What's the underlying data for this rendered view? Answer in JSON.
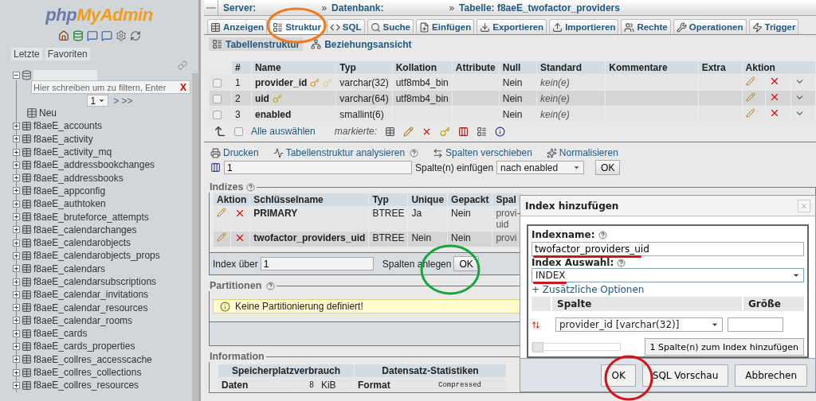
{
  "sidebar": {
    "logo": {
      "left": "php",
      "right": "MyAdmin"
    },
    "tabs": [
      {
        "label": "Letzte"
      },
      {
        "label": "Favoriten"
      }
    ],
    "filter": {
      "placeholder": "Hier schreiben um zu filtern, Enter",
      "clear": "X"
    },
    "pager": {
      "page": "1",
      "next": "> >>"
    },
    "new_label": "Neu",
    "tables": [
      "f8aeE_accounts",
      "f8aeE_activity",
      "f8aeE_activity_mq",
      "f8aeE_addressbookchanges",
      "f8aeE_addressbooks",
      "f8aeE_appconfig",
      "f8aeE_authtoken",
      "f8aeE_bruteforce_attempts",
      "f8aeE_calendarchanges",
      "f8aeE_calendarobjects",
      "f8aeE_calendarobjects_props",
      "f8aeE_calendars",
      "f8aeE_calendarsubscriptions",
      "f8aeE_calendar_invitations",
      "f8aeE_calendar_resources",
      "f8aeE_calendar_rooms",
      "f8aeE_cards",
      "f8aeE_cards_properties",
      "f8aeE_collres_accesscache",
      "f8aeE_collres_collections",
      "f8aeE_collres_resources"
    ]
  },
  "breadcrumb": [
    {
      "label": "Server:"
    },
    {
      "prefix": "»",
      "label": "Datenbank:"
    },
    {
      "prefix": "»",
      "label": "Tabelle: f8aeE_twofactor_providers"
    }
  ],
  "tabs": [
    {
      "label": "Anzeigen",
      "selected": false
    },
    {
      "label": "Struktur",
      "selected": true
    },
    {
      "label": "SQL",
      "selected": false
    },
    {
      "label": "Suche",
      "selected": false
    },
    {
      "label": "Einfügen",
      "selected": false
    },
    {
      "label": "Exportieren",
      "selected": false
    },
    {
      "label": "Importieren",
      "selected": false
    },
    {
      "label": "Rechte",
      "selected": false
    },
    {
      "label": "Operationen",
      "selected": false
    },
    {
      "label": "Trigger",
      "selected": false
    }
  ],
  "subtabs": [
    {
      "label": "Tabellenstruktur",
      "selected": true
    },
    {
      "label": "Beziehungsansicht",
      "selected": false
    }
  ],
  "structure": {
    "columns": [
      "#",
      "Name",
      "Typ",
      "Kollation",
      "Attribute",
      "Null",
      "Standard",
      "Kommentare",
      "Extra",
      "Aktion"
    ],
    "rows": [
      {
        "checked": false,
        "num": "1",
        "name": "provider_id",
        "keys": [
          {
            "kind": "primary"
          },
          {
            "kind": "index"
          }
        ],
        "type": "varchar(32)",
        "collation": "utf8mb4_bin",
        "null": "Nein",
        "default": "kein(e)"
      },
      {
        "checked": false,
        "num": "2",
        "name": "uid",
        "keys": [
          {
            "kind": "primary"
          }
        ],
        "type": "varchar(64)",
        "collation": "utf8mb4_bin",
        "null": "Nein",
        "default": "kein(e)"
      },
      {
        "checked": false,
        "num": "3",
        "name": "enabled",
        "type": "smallint(6)",
        "null": "Nein",
        "default": "kein(e)"
      }
    ],
    "select_all": "Alle auswählen",
    "select_all_checked": false,
    "with_selected": "markierte:"
  },
  "actions": [
    {
      "label": "Drucken",
      "help": false
    },
    {
      "label": "Tabellenstruktur analysieren",
      "help": true
    },
    {
      "label": "Spalten verschieben",
      "help": false
    },
    {
      "label": "Normalisieren",
      "help": false
    }
  ],
  "add_columns": {
    "count": "1",
    "label": "Spalte(n) einfügen",
    "position": "nach enabled",
    "button": "OK"
  },
  "indexes": {
    "legend": "Indizes",
    "columns": [
      "Aktion",
      "Schlüsselname",
      "Typ",
      "Unique",
      "Gepackt",
      "Spal"
    ],
    "rows": [
      {
        "name": "PRIMARY",
        "type": "BTREE",
        "unique": "Ja",
        "packed": "Nein",
        "columns": [
          "provi-",
          "uid"
        ]
      },
      {
        "name": "twofactor_providers_uid",
        "type": "BTREE",
        "unique": "Nein",
        "packed": "Nein",
        "columns": [
          "provi"
        ]
      }
    ],
    "create": {
      "label_before": "Index über",
      "count": "1",
      "label_after": "Spalten anlegen",
      "button": "OK"
    }
  },
  "partitions": {
    "legend": "Partitionen",
    "notice": "Keine Partitionierung definiert!"
  },
  "information": {
    "legend": "Information",
    "space_title": "Speicherplatzverbrauch",
    "stats_title": "Datensatz-Statistiken",
    "space_label": "Daten",
    "space_value": "8",
    "space_unit": "KiB",
    "stats_label": "Format",
    "stats_value": "Compressed"
  },
  "dialog": {
    "title": "Index hinzufügen",
    "name_label": "Indexname:",
    "name_value": "twofactor_providers_uid",
    "choice_label": "Index Auswahl:",
    "choice_value": "INDEX",
    "options_link": "+ Zusätzliche Optionen",
    "columns": [
      "Spalte",
      "Größe"
    ],
    "rows": [
      {
        "column": "provider_id [varchar(32)]"
      }
    ],
    "slider": {
      "level": 0
    },
    "add_button": "1 Spalte(n) zum Index hinzufügen",
    "buttons": [
      "OK",
      "SQL Vorschau",
      "Abbrechen"
    ]
  }
}
